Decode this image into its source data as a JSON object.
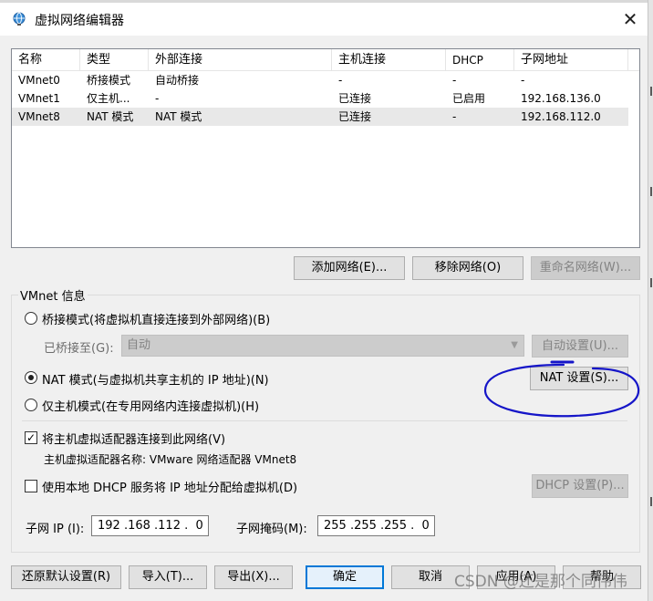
{
  "window": {
    "title": "虚拟网络编辑器",
    "close_glyph": "✕"
  },
  "table": {
    "headers": [
      "名称",
      "类型",
      "外部连接",
      "主机连接",
      "DHCP",
      "子网地址"
    ],
    "rows": [
      [
        "VMnet0",
        "桥接模式",
        "自动桥接",
        "-",
        "-",
        "-"
      ],
      [
        "VMnet1",
        "仅主机...",
        "-",
        "已连接",
        "已启用",
        "192.168.136.0"
      ],
      [
        "VMnet8",
        "NAT 模式",
        "NAT 模式",
        "已连接",
        "-",
        "192.168.112.0"
      ]
    ],
    "selected_row": 2
  },
  "network_buttons": {
    "add": "添加网络(E)...",
    "remove": "移除网络(O)",
    "rename": "重命名网络(W)..."
  },
  "vmnet_info": {
    "group_label": "VMnet 信息",
    "bridged_radio": "桥接模式(将虚拟机直接连接到外部网络)(B)",
    "bridged_to_label": "已桥接至(G):",
    "bridged_to_value": "自动",
    "auto_settings": "自动设置(U)...",
    "nat_radio": "NAT 模式(与虚拟机共享主机的 IP 地址)(N)",
    "nat_settings": "NAT 设置(S)...",
    "hostonly_radio": "仅主机模式(在专用网络内连接虚拟机)(H)",
    "selected_mode": "nat",
    "connect_adapter_check": "将主机虚拟适配器连接到此网络(V)",
    "connect_adapter_checked": true,
    "adapter_name": "主机虚拟适配器名称: VMware 网络适配器 VMnet8",
    "dhcp_check": "使用本地 DHCP 服务将 IP 地址分配给虚拟机(D)",
    "dhcp_checked": false,
    "dhcp_settings": "DHCP 设置(P)...",
    "subnet_ip_label": "子网 IP (I):",
    "subnet_ip": "192 .168 .112 .  0",
    "subnet_mask_label": "子网掩码(M):",
    "subnet_mask": "255 .255 .255 .  0"
  },
  "bottom_buttons": {
    "restore": "还原默认设置(R)",
    "import": "导入(T)...",
    "export": "导出(X)...",
    "ok": "确定",
    "cancel": "取消",
    "apply": "应用(A)",
    "help": "帮助"
  },
  "watermark": "CSDN @还是那个同伟伟",
  "colors": {
    "selection": "#e8e8e8",
    "default_button_border": "#0078d7",
    "annotation": "#1515c8"
  },
  "icons": {
    "title": "network-globe-icon",
    "checkmark": "✓"
  }
}
